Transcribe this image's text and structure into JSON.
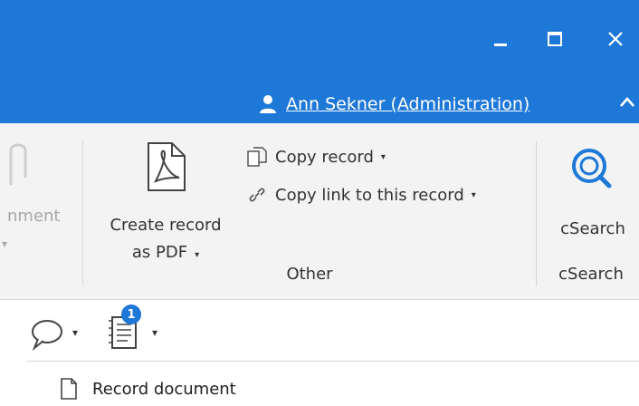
{
  "window": {
    "colors": {
      "titlebar": "#1e78d7",
      "ribbon": "#f3f3f3",
      "badge": "#1e78d7"
    },
    "controls": [
      "minimize-icon",
      "maximize-icon",
      "close-icon"
    ]
  },
  "user": {
    "name": "Ann Sekner (Administration)",
    "icon": "user-icon"
  },
  "ribbon": {
    "partial_left_label": "nment",
    "partial_left_caret": "▾",
    "create_pdf": {
      "line1": "Create record",
      "line2": "as PDF",
      "icon": "pdf-icon"
    },
    "copy_record": {
      "label": "Copy record",
      "icon": "copy-icon"
    },
    "copy_link": {
      "label": "Copy link to this record",
      "icon": "link-icon"
    },
    "group_other": "Other",
    "csearch": {
      "label": "cSearch",
      "icon": "csearch-icon"
    },
    "group_csearch": "cSearch"
  },
  "toolbar": {
    "comment_icon": "comment-icon",
    "notes_icon": "notes-icon",
    "notes_badge": "1"
  },
  "list": {
    "items": [
      {
        "label": "Record document",
        "icon": "document-icon"
      }
    ]
  }
}
